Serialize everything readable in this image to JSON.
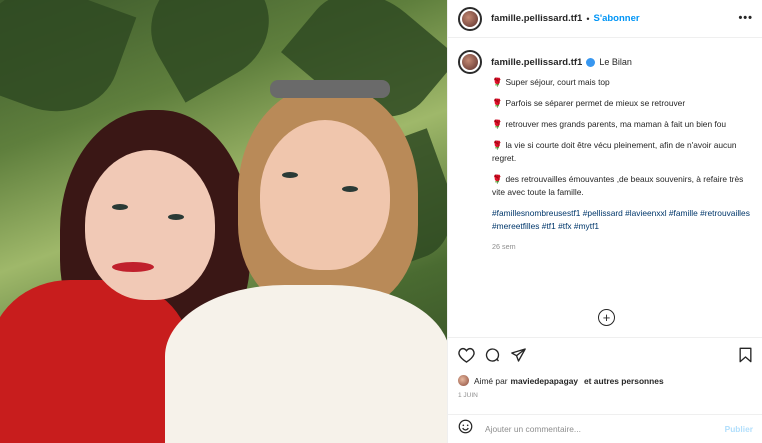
{
  "header": {
    "username": "famille.pellissard.tf1",
    "separator": "•",
    "follow_label": "S'abonner",
    "more_label": "•••"
  },
  "caption": {
    "username": "famille.pellissard.tf1",
    "title": "Le Bilan",
    "bullet": "🌹",
    "lines": [
      "Super séjour, court mais top",
      "Parfois se séparer permet de mieux se retrouver",
      "retrouver mes grands parents, ma maman à fait un bien fou",
      "la vie si courte doit être vécu pleinement, afin de n'avoir aucun regret.",
      "des retrouvailles émouvantes ,de beaux souvenirs, à refaire très vite avec toute la famille."
    ],
    "hashtags": "#famillesnombreusestf1 #pellissard #lavieenxxl #famille #retrouvailles #mereetfilles #tf1 #tfx #mytf1",
    "time_ago": "26 sem"
  },
  "more_comments_label": "+",
  "likes": {
    "prefix": "Aimé par",
    "liker": "maviedepapagay",
    "suffix": "et autres personnes"
  },
  "date": "1 JUIN",
  "comment": {
    "placeholder": "Ajouter un commentaire...",
    "publish_label": "Publier"
  },
  "colors": {
    "accent": "#0095f6",
    "hashtag": "#00376b",
    "muted": "#8e8e8e"
  }
}
